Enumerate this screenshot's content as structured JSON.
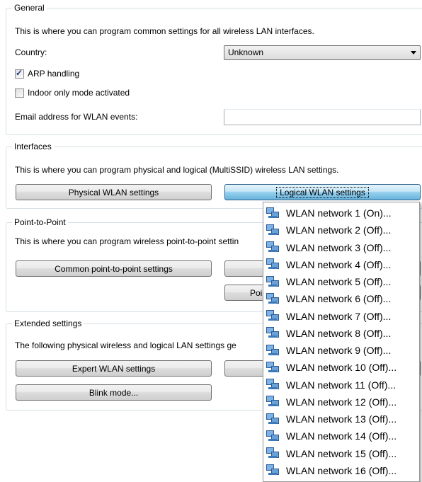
{
  "general": {
    "legend": "General",
    "description": "This is where you can program common settings for all wireless LAN interfaces.",
    "country_label": "Country:",
    "country_value": "Unknown",
    "arp_label": "ARP handling",
    "arp_checked": true,
    "indoor_label": "Indoor only mode activated",
    "indoor_checked": false,
    "email_label": "Email address for WLAN events:",
    "email_value": ""
  },
  "interfaces": {
    "legend": "Interfaces",
    "description": "This is where you can program physical and logical (MultiSSID) wireless LAN settings.",
    "physical_button": "Physical WLAN settings",
    "logical_button": "Logical WLAN settings"
  },
  "p2p": {
    "legend": "Point-to-Point",
    "description": "This is where you can program wireless point-to-point settin",
    "common_button": "Common point-to-point settings",
    "hidden_button_partial": "Poi"
  },
  "extended": {
    "legend": "Extended settings",
    "description": "The following physical wireless and logical LAN settings ge",
    "expert_button": "Expert WLAN settings",
    "blink_button": "Blink mode..."
  },
  "menu": {
    "icon": "network-icon",
    "items": [
      "WLAN network 1 (On)...",
      "WLAN network 2 (Off)...",
      "WLAN network 3 (Off)...",
      "WLAN network 4 (Off)...",
      "WLAN network 5 (Off)...",
      "WLAN network 6 (Off)...",
      "WLAN network 7 (Off)...",
      "WLAN network 8 (Off)...",
      "WLAN network 9 (Off)...",
      "WLAN network 10 (Off)...",
      "WLAN network 11 (Off)...",
      "WLAN network 12 (Off)...",
      "WLAN network 13 (Off)...",
      "WLAN network 14 (Off)...",
      "WLAN network 15 (Off)...",
      "WLAN network 16 (Off)..."
    ]
  }
}
